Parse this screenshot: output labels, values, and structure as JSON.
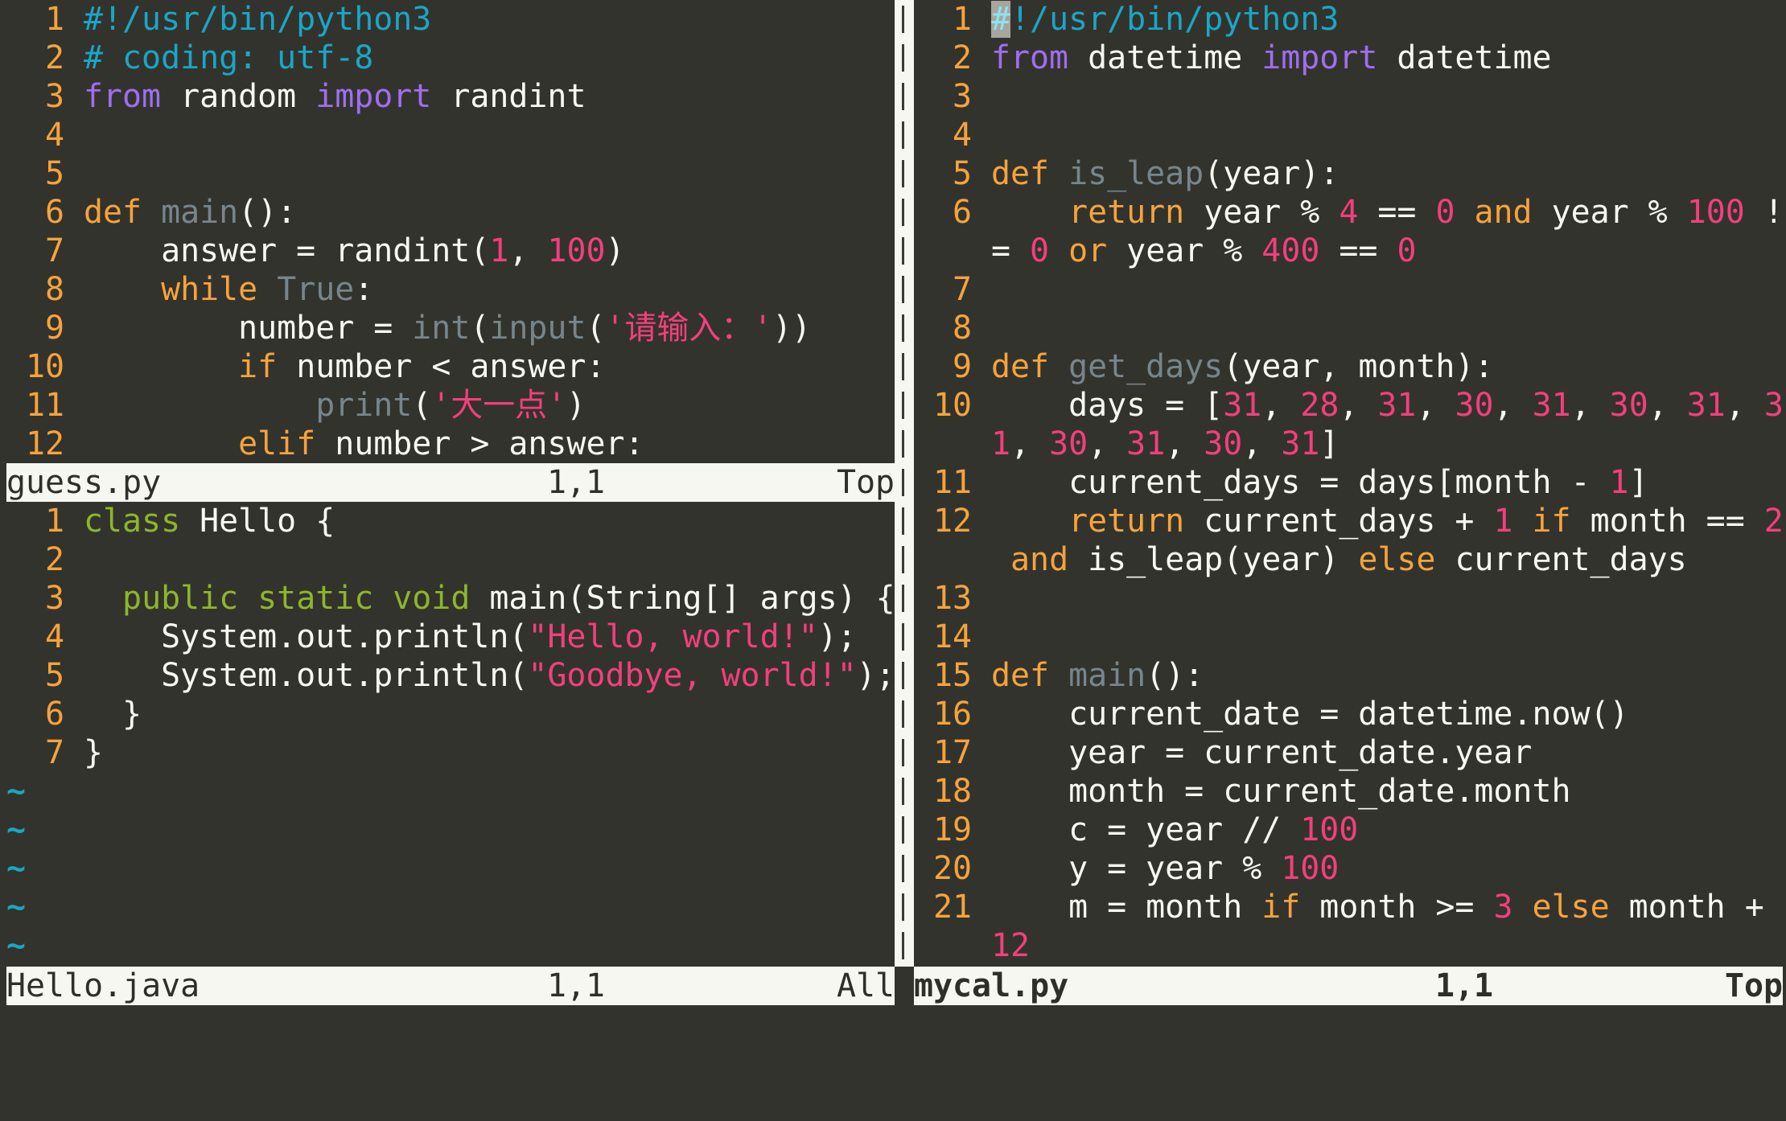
{
  "panes": {
    "guess": {
      "filename": "guess.py",
      "position": "1,1",
      "scroll": "Top",
      "lines": [
        {
          "n": "1",
          "tokens": [
            [
              "c",
              "#!/usr/bin/python3"
            ]
          ]
        },
        {
          "n": "2",
          "tokens": [
            [
              "c",
              "# coding: utf-8"
            ]
          ]
        },
        {
          "n": "3",
          "tokens": [
            [
              "p",
              "from"
            ],
            [
              "x",
              " random "
            ],
            [
              "p",
              "import"
            ],
            [
              "x",
              " randint"
            ]
          ]
        },
        {
          "n": "4",
          "tokens": []
        },
        {
          "n": "5",
          "tokens": []
        },
        {
          "n": "6",
          "tokens": [
            [
              "k",
              "def"
            ],
            [
              "x",
              " "
            ],
            [
              "f",
              "main"
            ],
            [
              "x",
              "():"
            ]
          ]
        },
        {
          "n": "7",
          "tokens": [
            [
              "x",
              "    answer = randint("
            ],
            [
              "s",
              "1"
            ],
            [
              "x",
              ", "
            ],
            [
              "s",
              "100"
            ],
            [
              "x",
              ")"
            ]
          ]
        },
        {
          "n": "8",
          "tokens": [
            [
              "x",
              "    "
            ],
            [
              "k",
              "while"
            ],
            [
              "x",
              " "
            ],
            [
              "f",
              "True"
            ],
            [
              "x",
              ":"
            ]
          ]
        },
        {
          "n": "9",
          "tokens": [
            [
              "x",
              "        number = "
            ],
            [
              "f",
              "int"
            ],
            [
              "x",
              "("
            ],
            [
              "f",
              "input"
            ],
            [
              "x",
              "("
            ],
            [
              "s",
              "'请输入：'"
            ],
            [
              "x",
              "))"
            ]
          ]
        },
        {
          "n": "10",
          "tokens": [
            [
              "x",
              "        "
            ],
            [
              "k",
              "if"
            ],
            [
              "x",
              " number < answer:"
            ]
          ]
        },
        {
          "n": "11",
          "tokens": [
            [
              "x",
              "            "
            ],
            [
              "f",
              "print"
            ],
            [
              "x",
              "("
            ],
            [
              "s",
              "'大一点'"
            ],
            [
              "x",
              ")"
            ]
          ]
        },
        {
          "n": "12",
          "tokens": [
            [
              "x",
              "        "
            ],
            [
              "k",
              "elif"
            ],
            [
              "x",
              " number > answer:"
            ]
          ]
        }
      ]
    },
    "hello": {
      "filename": "Hello.java",
      "position": "1,1",
      "scroll": "All",
      "lines": [
        {
          "n": "1",
          "tokens": [
            [
              "j",
              "class"
            ],
            [
              "x",
              " Hello {"
            ]
          ]
        },
        {
          "n": "2",
          "tokens": []
        },
        {
          "n": "3",
          "tokens": [
            [
              "x",
              "  "
            ],
            [
              "j",
              "public static void"
            ],
            [
              "x",
              " main(String[] args) {"
            ]
          ]
        },
        {
          "n": "4",
          "tokens": [
            [
              "x",
              "    System.out.println("
            ],
            [
              "s",
              "\"Hello, world!\""
            ],
            [
              "x",
              ");"
            ]
          ]
        },
        {
          "n": "5",
          "tokens": [
            [
              "x",
              "    System.out.println("
            ],
            [
              "s",
              "\"Goodbye, world!\""
            ],
            [
              "x",
              ");"
            ]
          ]
        },
        {
          "n": "6",
          "tokens": [
            [
              "x",
              "  }"
            ]
          ]
        },
        {
          "n": "7",
          "tokens": [
            [
              "x",
              "}"
            ]
          ]
        }
      ],
      "empty_marker": "~",
      "empty_rows": 5
    },
    "mycal": {
      "filename": "mycal.py",
      "position": "1,1",
      "scroll": "Top",
      "active": true,
      "lines": [
        {
          "n": "1",
          "tokens": [
            [
              "cur",
              "#"
            ],
            [
              "c",
              "!/usr/bin/python3"
            ]
          ]
        },
        {
          "n": "2",
          "tokens": [
            [
              "p",
              "from"
            ],
            [
              "x",
              " datetime "
            ],
            [
              "p",
              "import"
            ],
            [
              "x",
              " datetime"
            ]
          ]
        },
        {
          "n": "3",
          "tokens": []
        },
        {
          "n": "4",
          "tokens": []
        },
        {
          "n": "5",
          "tokens": [
            [
              "k",
              "def"
            ],
            [
              "x",
              " "
            ],
            [
              "f",
              "is_leap"
            ],
            [
              "x",
              "(year):"
            ]
          ]
        },
        {
          "n": "6",
          "tokens": [
            [
              "x",
              "    "
            ],
            [
              "k",
              "return"
            ],
            [
              "x",
              " year % "
            ],
            [
              "s",
              "4"
            ],
            [
              "x",
              " == "
            ],
            [
              "s",
              "0"
            ],
            [
              "x",
              " "
            ],
            [
              "k",
              "and"
            ],
            [
              "x",
              " year % "
            ],
            [
              "s",
              "100"
            ],
            [
              "x",
              " !"
            ]
          ]
        },
        {
          "n": "",
          "tokens": [
            [
              "x",
              "= "
            ],
            [
              "s",
              "0"
            ],
            [
              "x",
              " "
            ],
            [
              "k",
              "or"
            ],
            [
              "x",
              " year % "
            ],
            [
              "s",
              "400"
            ],
            [
              "x",
              " == "
            ],
            [
              "s",
              "0"
            ]
          ]
        },
        {
          "n": "7",
          "tokens": []
        },
        {
          "n": "8",
          "tokens": []
        },
        {
          "n": "9",
          "tokens": [
            [
              "k",
              "def"
            ],
            [
              "x",
              " "
            ],
            [
              "f",
              "get_days"
            ],
            [
              "x",
              "(year, month):"
            ]
          ]
        },
        {
          "n": "10",
          "tokens": [
            [
              "x",
              "    days = ["
            ],
            [
              "s",
              "31"
            ],
            [
              "x",
              ", "
            ],
            [
              "s",
              "28"
            ],
            [
              "x",
              ", "
            ],
            [
              "s",
              "31"
            ],
            [
              "x",
              ", "
            ],
            [
              "s",
              "30"
            ],
            [
              "x",
              ", "
            ],
            [
              "s",
              "31"
            ],
            [
              "x",
              ", "
            ],
            [
              "s",
              "30"
            ],
            [
              "x",
              ", "
            ],
            [
              "s",
              "31"
            ],
            [
              "x",
              ", "
            ],
            [
              "s",
              "3"
            ]
          ]
        },
        {
          "n": "",
          "tokens": [
            [
              "s",
              "1"
            ],
            [
              "x",
              ", "
            ],
            [
              "s",
              "30"
            ],
            [
              "x",
              ", "
            ],
            [
              "s",
              "31"
            ],
            [
              "x",
              ", "
            ],
            [
              "s",
              "30"
            ],
            [
              "x",
              ", "
            ],
            [
              "s",
              "31"
            ],
            [
              "x",
              "]"
            ]
          ]
        },
        {
          "n": "11",
          "tokens": [
            [
              "x",
              "    current_days = days[month - "
            ],
            [
              "s",
              "1"
            ],
            [
              "x",
              "]"
            ]
          ]
        },
        {
          "n": "12",
          "tokens": [
            [
              "x",
              "    "
            ],
            [
              "k",
              "return"
            ],
            [
              "x",
              " current_days + "
            ],
            [
              "s",
              "1"
            ],
            [
              "x",
              " "
            ],
            [
              "k",
              "if"
            ],
            [
              "x",
              " month == "
            ],
            [
              "s",
              "2"
            ]
          ]
        },
        {
          "n": "",
          "tokens": [
            [
              "x",
              " "
            ],
            [
              "k",
              "and"
            ],
            [
              "x",
              " is_leap(year) "
            ],
            [
              "k",
              "else"
            ],
            [
              "x",
              " current_days"
            ]
          ]
        },
        {
          "n": "13",
          "tokens": []
        },
        {
          "n": "14",
          "tokens": []
        },
        {
          "n": "15",
          "tokens": [
            [
              "k",
              "def"
            ],
            [
              "x",
              " "
            ],
            [
              "f",
              "main"
            ],
            [
              "x",
              "():"
            ]
          ]
        },
        {
          "n": "16",
          "tokens": [
            [
              "x",
              "    current_date = datetime.now()"
            ]
          ]
        },
        {
          "n": "17",
          "tokens": [
            [
              "x",
              "    year = current_date.year"
            ]
          ]
        },
        {
          "n": "18",
          "tokens": [
            [
              "x",
              "    month = current_date.month"
            ]
          ]
        },
        {
          "n": "19",
          "tokens": [
            [
              "x",
              "    c = year // "
            ],
            [
              "s",
              "100"
            ]
          ]
        },
        {
          "n": "20",
          "tokens": [
            [
              "x",
              "    y = year % "
            ],
            [
              "s",
              "100"
            ]
          ]
        },
        {
          "n": "21",
          "tokens": [
            [
              "x",
              "    m = month "
            ],
            [
              "k",
              "if"
            ],
            [
              "x",
              " month >= "
            ],
            [
              "s",
              "3"
            ],
            [
              "x",
              " "
            ],
            [
              "k",
              "else"
            ],
            [
              "x",
              " month +"
            ]
          ]
        },
        {
          "n": "",
          "tokens": [
            [
              "s",
              "12"
            ]
          ]
        }
      ]
    }
  },
  "separator_char": "|",
  "colors": {
    "background": "#33332d",
    "line_number": "#f5a33c",
    "comment": "#1aa6c6",
    "import_keyword": "#9d6ff0",
    "keyword": "#f5a33c",
    "function": "#77858c",
    "literal": "#f23f7e",
    "java_keyword": "#8cb62c",
    "status_bar_bg": "#f7f7f2"
  }
}
